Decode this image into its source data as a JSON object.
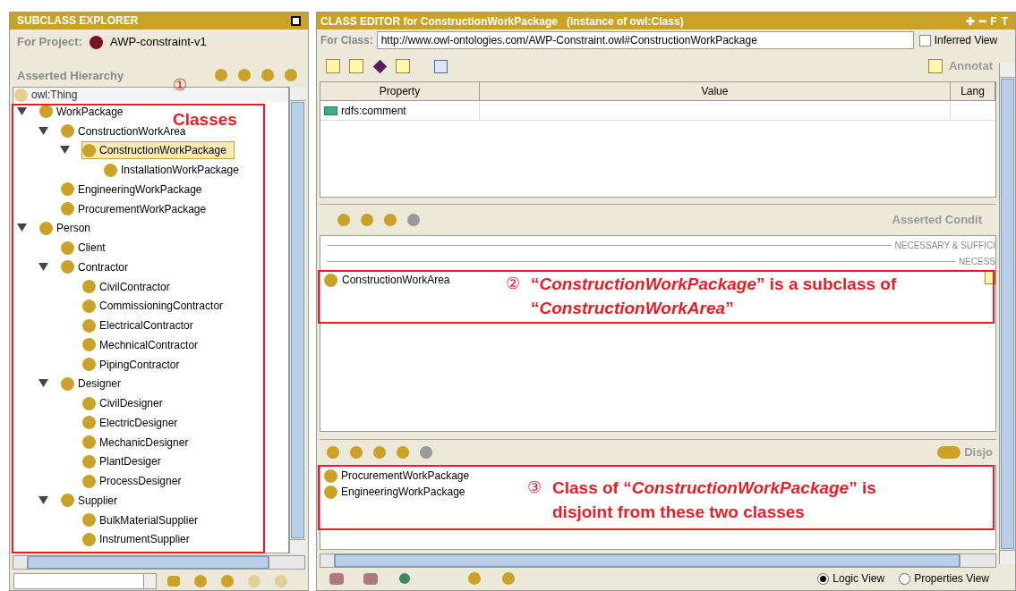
{
  "left_panel": {
    "title": "SUBCLASS EXPLORER",
    "project_label": "For Project:",
    "project_name": "AWP-constraint-v1",
    "hierarchy_label": "Asserted Hierarchy",
    "root": "owl:Thing",
    "tree": [
      {
        "label": "WorkPackage",
        "expanded": true,
        "selected": false,
        "children": [
          {
            "label": "ConstructionWorkArea",
            "expanded": true,
            "selected": false,
            "children": [
              {
                "label": "ConstructionWorkPackage",
                "expanded": true,
                "selected": true,
                "children": [
                  {
                    "label": "InstallationWorkPackage",
                    "selected": false
                  }
                ]
              }
            ]
          },
          {
            "label": "EngineeringWorkPackage",
            "selected": false
          },
          {
            "label": "ProcurementWorkPackage",
            "selected": false
          }
        ]
      },
      {
        "label": "Person",
        "expanded": true,
        "selected": false,
        "children": [
          {
            "label": "Client",
            "selected": false
          },
          {
            "label": "Contractor",
            "expanded": true,
            "selected": false,
            "children": [
              {
                "label": "CivilContractor",
                "selected": false
              },
              {
                "label": "CommissioningContractor",
                "selected": false
              },
              {
                "label": "ElectricalContractor",
                "selected": false
              },
              {
                "label": "MechnicalContractor",
                "selected": false
              },
              {
                "label": "PipingContractor",
                "selected": false
              }
            ]
          },
          {
            "label": "Designer",
            "expanded": true,
            "selected": false,
            "children": [
              {
                "label": "CivilDesigner",
                "selected": false
              },
              {
                "label": "ElectricDesigner",
                "selected": false
              },
              {
                "label": "MechanicDesigner",
                "selected": false
              },
              {
                "label": "PlantDesiger",
                "selected": false
              },
              {
                "label": "ProcessDesigner",
                "selected": false
              }
            ]
          },
          {
            "label": "Supplier",
            "expanded": true,
            "selected": false,
            "children": [
              {
                "label": "BulkMaterialSupplier",
                "selected": false
              },
              {
                "label": "InstrumentSupplier",
                "selected": false
              }
            ]
          }
        ]
      }
    ]
  },
  "right_panel": {
    "title": "CLASS EDITOR for ConstructionWorkPackage   (instance of owl:Class)",
    "title_buttons": [
      "✚",
      "━",
      "F",
      "T"
    ],
    "for_class_label": "For Class:",
    "for_class_value": "http://www.owl-ontologies.com/AWP-Constraint.owl#ConstructionWorkPackage",
    "inferred_view": {
      "label": "Inferred View",
      "checked": false
    },
    "annotations_label": "Annotat",
    "table": {
      "columns": [
        "Property",
        "Value",
        "Lang"
      ],
      "rows": [
        {
          "property": "rdfs:comment"
        }
      ]
    },
    "conditions_label": "Asserted Condit",
    "necessary_sufficient": "NECESSARY & SUFFICI",
    "necessary": "NECESS",
    "conditions": [
      "ConstructionWorkArea"
    ],
    "disjoint_label": "Disjo",
    "disjoints": [
      "ProcurementWorkPackage",
      "EngineeringWorkPackage"
    ],
    "views": [
      {
        "label": "Logic View",
        "selected": true
      },
      {
        "label": "Properties View",
        "selected": false
      }
    ]
  },
  "annotations": [
    {
      "number": "①",
      "text": "Classes"
    },
    {
      "number": "②",
      "text": "“*ConstructionWorkPackage*” is a subclass of “*ConstructionWorkArea*”"
    },
    {
      "number": "③",
      "text": "Class of “*ConstructionWorkPackage*” is disjoint from these two classes"
    }
  ]
}
